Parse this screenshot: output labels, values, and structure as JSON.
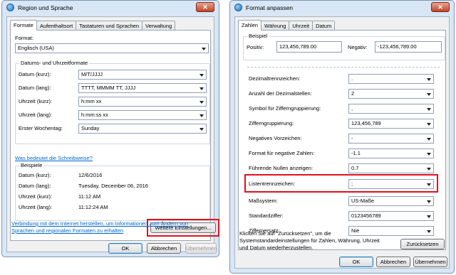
{
  "left": {
    "title": "Region und Sprache",
    "tabs": [
      "Formate",
      "Aufenthaltsort",
      "Tastaturen und Sprachen",
      "Verwaltung"
    ],
    "format_label": "Format:",
    "format_value": "Englisch (USA)",
    "datetime_group": "Datums- und Uhrzeitformate",
    "rows": [
      {
        "label": "Datum (kurz):",
        "value": "M/T/JJJJ"
      },
      {
        "label": "Datum (lang):",
        "value": "TTTT, MMMM TT, JJJJ"
      },
      {
        "label": "Uhrzeit (kurz):",
        "value": "h:mm xx"
      },
      {
        "label": "Uhrzeit (lang):",
        "value": "h:mm:ss xx"
      },
      {
        "label": "Erster Wochentag:",
        "value": "Sunday"
      }
    ],
    "notation_link": "Was bedeutet die Schreibweise?",
    "examples_group": "Beispiele",
    "examples": [
      {
        "label": "Datum (kurz):",
        "value": "12/6/2016"
      },
      {
        "label": "Datum (lang):",
        "value": "Tuesday, December 06, 2016"
      },
      {
        "label": "Uhrzeit (kurz):",
        "value": "11:12 AM"
      },
      {
        "label": "Uhrzeit (lang):",
        "value": "11:12:24 AM"
      }
    ],
    "more_settings_button": "Weitere Einstellungen...",
    "connect_link_line1": "Verbindung mit dem Internet herstellen, um Informationen zum Ändern von",
    "connect_link_line2": "Sprachen und regionalen Formaten zu erhalten",
    "ok": "OK",
    "cancel": "Abbrechen",
    "apply": "Übernehmen"
  },
  "right": {
    "title": "Format anpassen",
    "tabs": [
      "Zahlen",
      "Währung",
      "Uhrzeit",
      "Datum"
    ],
    "example_group": "Beispiel",
    "positive_label": "Positiv:",
    "positive_value": "123,456,789.00",
    "negative_label": "Negativ:",
    "negative_value": "-123,456,789.00",
    "rows": [
      {
        "label": "Dezimaltrennzeichen:",
        "value": "."
      },
      {
        "label": "Anzahl der Dezimalstellen:",
        "value": "2"
      },
      {
        "label": "Symbol für Ziffern­gruppierung:",
        "value": ","
      },
      {
        "label": "Zifferngruppierung:",
        "value": "123,456,789"
      },
      {
        "label": "Negatives Vorzeichen:",
        "value": "-"
      },
      {
        "label": "Format für negative Zahlen:",
        "value": "-1.1"
      },
      {
        "label": "Führende Nullen anzeigen:",
        "value": "0.7"
      },
      {
        "label": "Listentrennzeichen:",
        "value": ";"
      },
      {
        "label": "Maßsystem:",
        "value": "US-Maße"
      },
      {
        "label": "Standardziffer:",
        "value": "0123456789"
      },
      {
        "label": "Ziffernersatz:",
        "value": "Nie"
      }
    ],
    "reset_text_line1": "Klicken Sie auf \"Zurücksetzen\", um die",
    "reset_text_line2": "Systemstandardeinstellungen für Zahlen, Währung, Uhrzeit",
    "reset_text_line3": "und Datum wiederherzustellen.",
    "reset_button": "Zurücksetzen",
    "ok": "OK",
    "cancel": "Abbrechen",
    "apply": "Übernehmen"
  },
  "colors": {
    "highlight": "#e0101e",
    "link": "#0066cc",
    "frame": "#d9e6f5"
  },
  "icons": [
    "globe-icon",
    "close-icon",
    "chevron-down-icon"
  ]
}
